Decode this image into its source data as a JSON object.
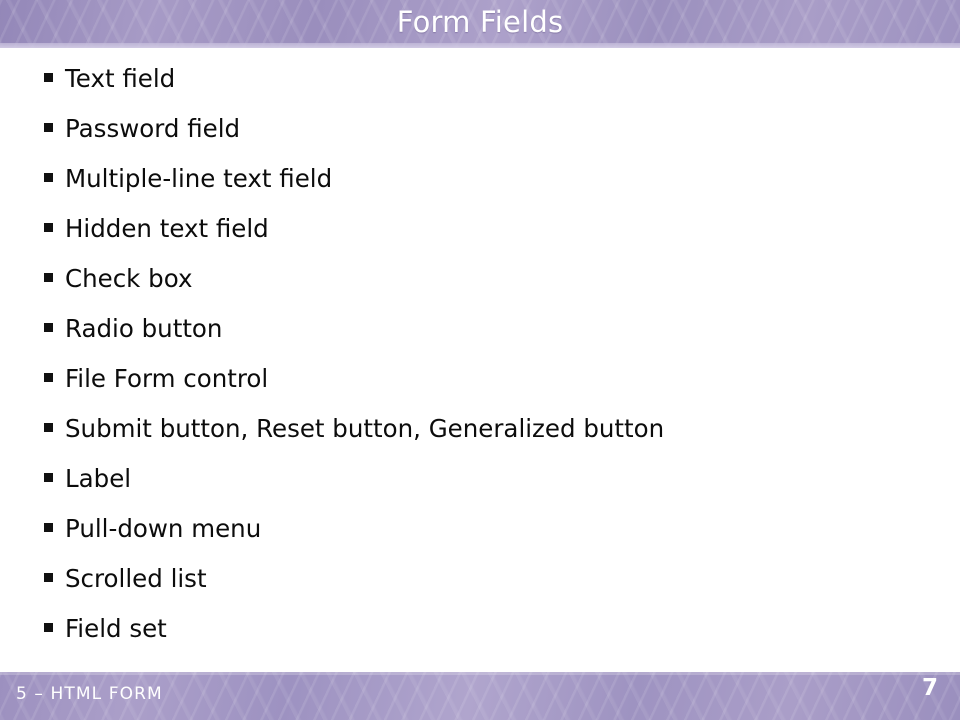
{
  "slide": {
    "title": "Form Fields",
    "bullets": [
      {
        "marker": "square-bullet-icon",
        "label": "Text field"
      },
      {
        "marker": "square-bullet-icon",
        "label": "Password field"
      },
      {
        "marker": "square-bullet-icon",
        "label": "Multiple-line text field"
      },
      {
        "marker": "square-bullet-icon",
        "label": "Hidden text field"
      },
      {
        "marker": "square-bullet-icon",
        "label": "Check box"
      },
      {
        "marker": "square-bullet-icon",
        "label": "Radio button"
      },
      {
        "marker": "square-bullet-icon",
        "label": "File Form control"
      },
      {
        "marker": "square-bullet-icon",
        "label": "Submit button, Reset button, Generalized button"
      },
      {
        "marker": "square-bullet-icon",
        "label": "Label"
      },
      {
        "marker": "square-bullet-icon",
        "label": "Pull-down menu"
      },
      {
        "marker": "square-bullet-icon",
        "label": "Scrolled list"
      },
      {
        "marker": "square-bullet-icon",
        "label": "Field set"
      }
    ],
    "footer": {
      "section_label": "5 – HTML FORM",
      "page_number": "7"
    },
    "colors": {
      "banner_purple": "#9d92c0",
      "banner_light_purple": "#ada1ca",
      "banner_edge": "#d3cce5",
      "title_text": "#ffffff",
      "body_text": "#0c0c0c",
      "bullet_marker": "#111111",
      "slide_background": "#ffffff"
    }
  }
}
